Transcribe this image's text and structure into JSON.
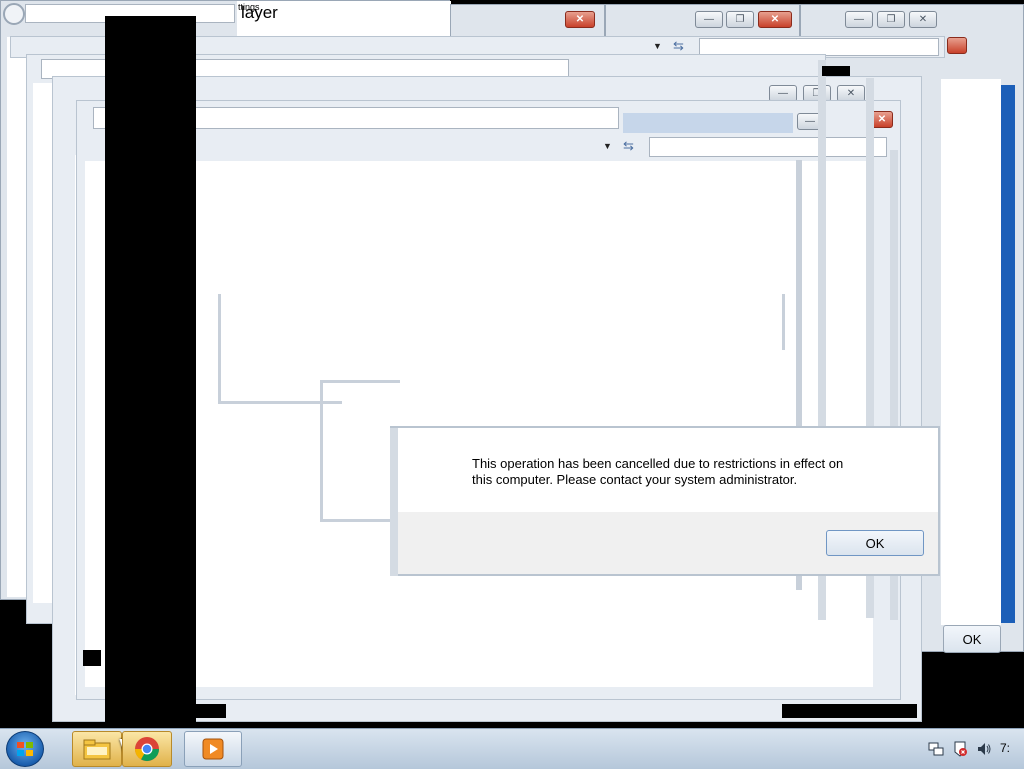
{
  "window_back": {
    "title_fragment_small": "ttings",
    "title_fragment_large": "layer"
  },
  "dialog": {
    "message_line1": "This operation has been cancelled due to restrictions in effect on",
    "message_line2": "this computer. Please contact your system administrator.",
    "ok_label": "OK"
  },
  "dialog_behind": {
    "ok_label": "OK"
  },
  "titlebar_buttons": {
    "minimize": "—",
    "maximize": "❐",
    "close": "✕"
  },
  "taskbar": {
    "start_icon": "windows-orb-icon",
    "items": [
      {
        "icon": "file-explorer-icon"
      },
      {
        "icon": "chrome-icon"
      },
      {
        "icon": "media-player-icon"
      }
    ],
    "tray": {
      "icons": [
        "network-icon",
        "action-center-icon",
        "volume-icon"
      ],
      "clock": "7:"
    }
  },
  "colors": {
    "frame": "#dfe5ec",
    "taskbar": "#c9d7e6",
    "close": "#c8412a"
  }
}
